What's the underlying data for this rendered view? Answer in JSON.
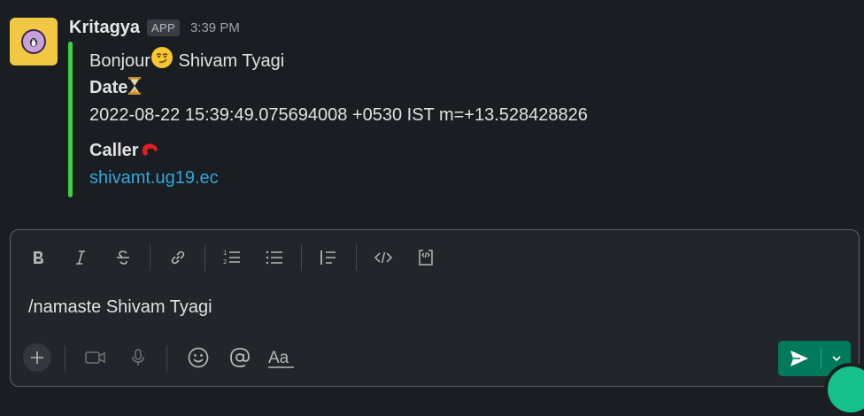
{
  "message": {
    "sender": "Kritagya",
    "badge": "APP",
    "time": "3:39 PM",
    "greeting_prefix": "Bonjour",
    "greeting_name": " Shivam Tyagi",
    "date_label": "Date",
    "date_value": "2022-08-22 15:39:49.075694008 +0530 IST m=+13.528428826",
    "caller_label": "Caller",
    "caller_value": "shivamt.ug19.ec"
  },
  "composer": {
    "text": "/namaste Shivam Tyagi"
  },
  "colors": {
    "attachment_bar": "#3dd13d",
    "link": "#2fa8dc",
    "send": "#007a5a",
    "avatar_bg": "#f2c744"
  }
}
